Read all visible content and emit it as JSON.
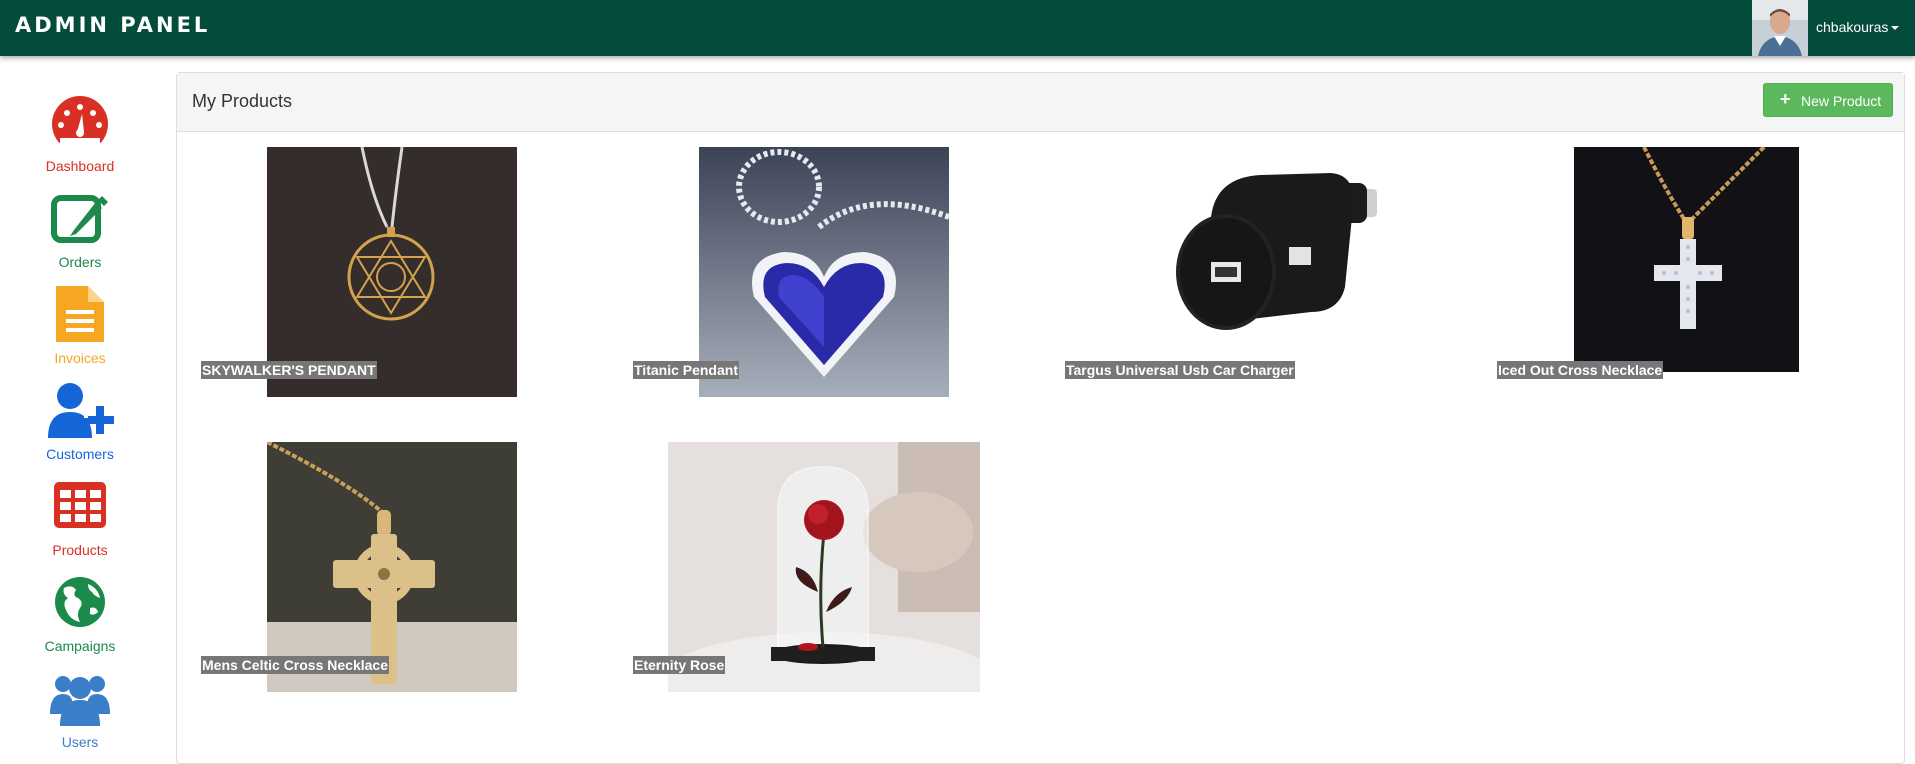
{
  "app": {
    "brand": "ADMIN PANEL"
  },
  "user": {
    "name": "chbakouras"
  },
  "sidebar": {
    "items": [
      {
        "label": "Dashboard",
        "icon": "dashboard-gauge-icon",
        "color": "#d93025"
      },
      {
        "label": "Orders",
        "icon": "edit-icon",
        "color": "#1b8a4a"
      },
      {
        "label": "Invoices",
        "icon": "document-icon",
        "color": "#f5a623"
      },
      {
        "label": "Customers",
        "icon": "add-user-icon",
        "color": "#1565d8"
      },
      {
        "label": "Products",
        "icon": "grid-table-icon",
        "color": "#d93025"
      },
      {
        "label": "Campaigns",
        "icon": "globe-icon",
        "color": "#1b8a4a"
      },
      {
        "label": "Users",
        "icon": "users-icon",
        "color": "#3a7dc9"
      }
    ]
  },
  "panel": {
    "title": "My Products",
    "new_button_label": "New Product"
  },
  "products": [
    {
      "name": "SKYWALKER'S PENDANT"
    },
    {
      "name": "Titanic Pendant"
    },
    {
      "name": "Targus Universal Usb Car Charger"
    },
    {
      "name": "Iced Out Cross Necklace"
    },
    {
      "name": "Mens Celtic Cross Necklace"
    },
    {
      "name": "Eternity Rose"
    }
  ],
  "colors": {
    "navbar": "#034b3b",
    "success": "#5cb85c",
    "label_bg": "#777777"
  }
}
